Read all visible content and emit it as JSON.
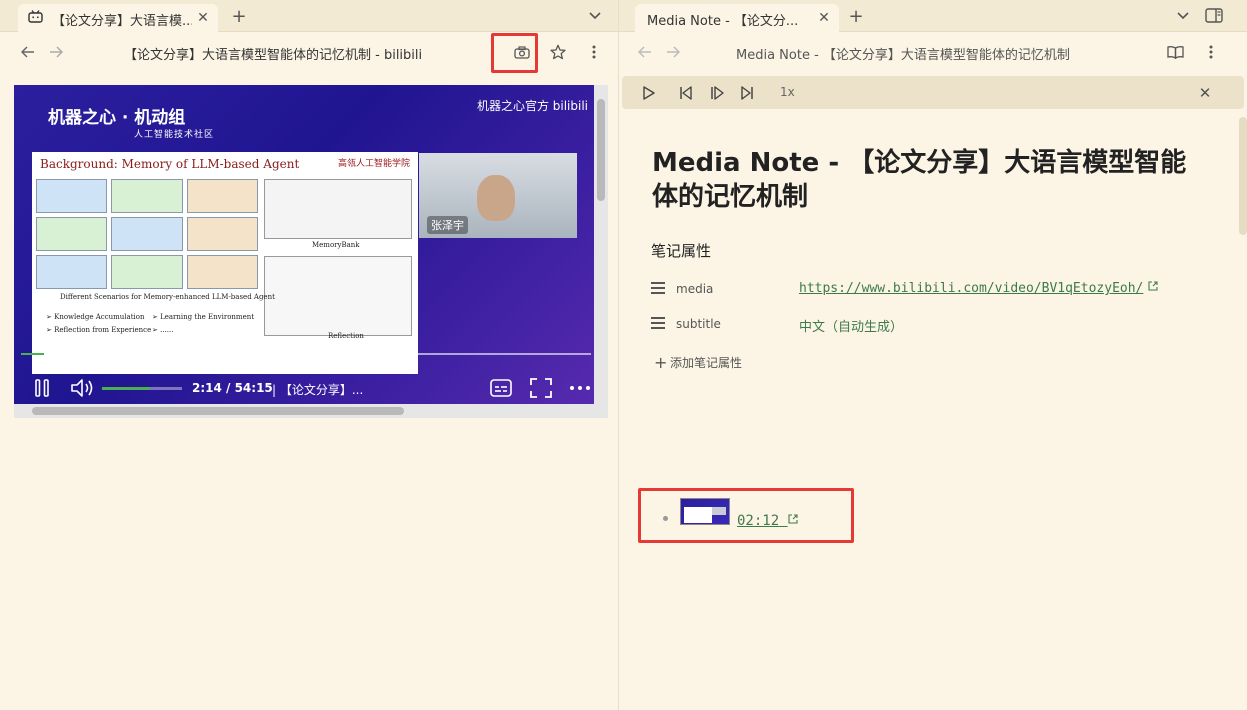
{
  "left_tab": {
    "title": "【论文分享】大语言模...",
    "icon": "bilibili-icon",
    "close_icon": "close-icon"
  },
  "left_tabbar": {
    "new_tab_icon": "plus-icon",
    "menu_icon": "chevron-down-icon"
  },
  "left_nav": {
    "title": "【论文分享】大语言模型智能体的记忆机制 - bilibili",
    "back_icon": "arrow-left-icon",
    "forward_icon": "arrow-right-icon",
    "screenshot_icon": "camera-icon",
    "bookmark_icon": "star-icon",
    "more_icon": "more-vertical-icon"
  },
  "video": {
    "logo": "机器之心 · 机动组",
    "logo_sub": "人工智能技术社区",
    "brand": "机器之心官方 bilibili",
    "slide_title": "Background: Memory of LLM-based Agent",
    "slide_university": "高瓴人工智能学院",
    "slide_caption_left": "Different Scenarios for Memory-enhanced LLM-based Agent",
    "slide_caption_memorybank": "MemoryBank",
    "slide_caption_reflection": "Reflection",
    "slide_bullets": [
      "Knowledge Accumulation",
      "Learning the Environment",
      "Reflection from Experience",
      "......"
    ],
    "speaker_name": "张泽宇",
    "time": "2:14 / 54:15",
    "title_short": "| 【论文分享】...",
    "progress": 0.041,
    "volume": 0.6
  },
  "right_tab": {
    "title": "Media Note - 【论文分...",
    "close_icon": "close-icon"
  },
  "right_tabbar": {
    "new_tab_icon": "plus-icon",
    "menu_icon": "chevron-down-icon",
    "sidebar_icon": "sidebar-icon"
  },
  "right_nav": {
    "title": "Media Note - 【论文分享】大语言模型智能体的记忆机制",
    "reading_icon": "book-icon",
    "more_icon": "more-vertical-icon"
  },
  "player": {
    "speed": "1x"
  },
  "note": {
    "title": "Media Note - 【论文分享】大语言模型智能体的记忆机制",
    "props_heading": "笔记属性",
    "props": [
      {
        "key": "media",
        "value": "https://www.bilibili.com/video/BV1qEtozyEoh/"
      },
      {
        "key": "subtitle",
        "value": "中文（自动生成）"
      }
    ],
    "add_prop": "添加笔记属性",
    "timestamp": "02:12"
  }
}
